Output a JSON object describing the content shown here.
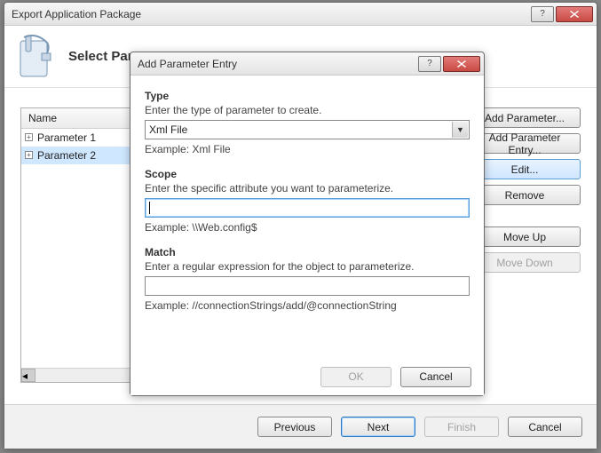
{
  "main": {
    "title": "Export Application Package",
    "banner_heading": "Select Parameters",
    "tree": {
      "header": "Name",
      "items": [
        {
          "label": "Parameter 1",
          "selected": false
        },
        {
          "label": "Parameter 2",
          "selected": true
        }
      ]
    },
    "side_buttons": {
      "add_parameter": "Add Parameter...",
      "add_parameter_entry": "Add Parameter Entry...",
      "edit": "Edit...",
      "remove": "Remove",
      "move_up": "Move Up",
      "move_down": "Move Down"
    },
    "footer": {
      "previous": "Previous",
      "next": "Next",
      "finish": "Finish",
      "cancel": "Cancel"
    }
  },
  "modal": {
    "title": "Add Parameter Entry",
    "type": {
      "label": "Type",
      "desc": "Enter the type of parameter to create.",
      "value": "Xml File",
      "example": "Example: Xml File"
    },
    "scope": {
      "label": "Scope",
      "desc": "Enter the specific attribute you want to parameterize.",
      "value": "",
      "example": "Example: \\\\Web.config$"
    },
    "match": {
      "label": "Match",
      "desc": "Enter a regular expression for the object to parameterize.",
      "value": "",
      "example": "Example: //connectionStrings/add/@connectionString"
    },
    "footer": {
      "ok": "OK",
      "cancel": "Cancel"
    }
  }
}
